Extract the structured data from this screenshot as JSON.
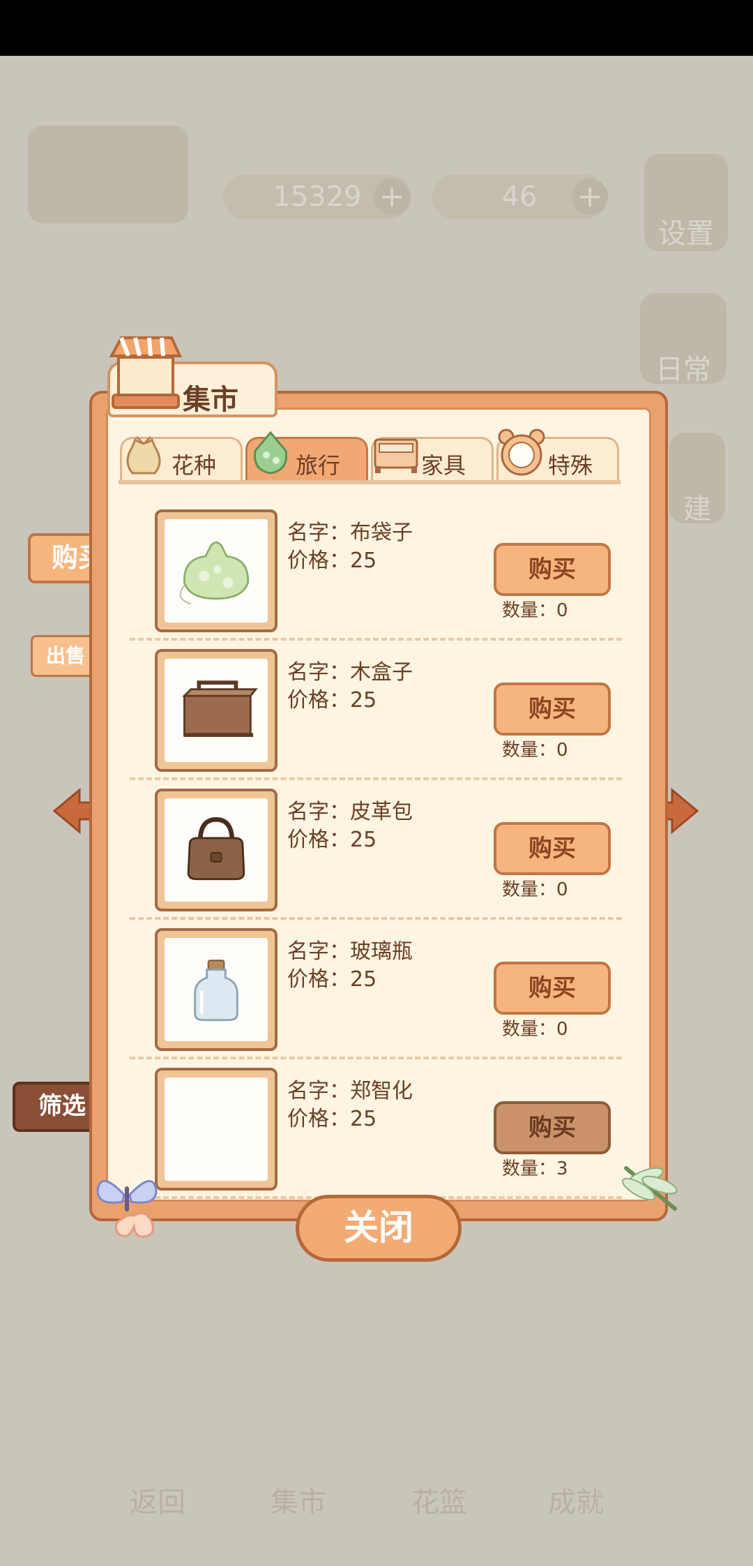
{
  "background_hud": {
    "coins": "15329",
    "gems": "46",
    "settings_label": "设置",
    "daily_label": "日常",
    "build_label": "建",
    "bottom_nav": [
      "返回",
      "集市",
      "花篮",
      "成就"
    ]
  },
  "market": {
    "title": "集市",
    "tabs": [
      {
        "label": "花种",
        "active": false
      },
      {
        "label": "旅行",
        "active": true
      },
      {
        "label": "家具",
        "active": false
      },
      {
        "label": "特殊",
        "active": false
      }
    ],
    "items": [
      {
        "name": "名字：布袋子",
        "price": "价格：25",
        "buy_label": "购买",
        "qty": "数量：0",
        "icon": "cloth-bag-icon"
      },
      {
        "name": "名字：木盒子",
        "price": "价格：25",
        "buy_label": "购买",
        "qty": "数量：0",
        "icon": "wooden-box-icon"
      },
      {
        "name": "名字：皮革包",
        "price": "价格：25",
        "buy_label": "购买",
        "qty": "数量：0",
        "icon": "leather-bag-icon"
      },
      {
        "name": "名字：玻璃瓶",
        "price": "价格：25",
        "buy_label": "购买",
        "qty": "数量：0",
        "icon": "glass-bottle-icon"
      },
      {
        "name": "名字：郑智化",
        "price": "价格：25",
        "buy_label": "购买",
        "qty": "数量：3",
        "icon": "blank-icon"
      }
    ],
    "side_buy": "购买",
    "side_sell": "出售",
    "side_filter": "筛选",
    "close_label": "关闭",
    "accent": "#e9a16e",
    "border": "#b5673a"
  }
}
